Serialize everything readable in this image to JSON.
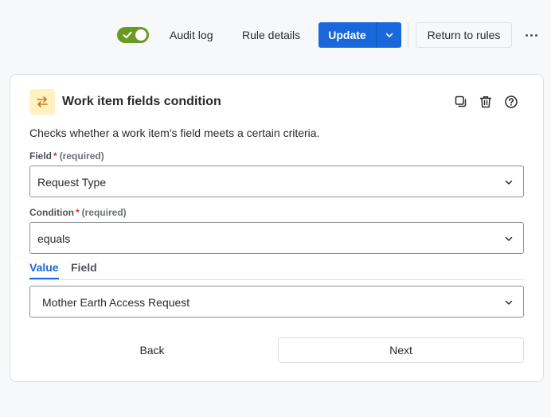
{
  "toolbar": {
    "rule_enabled": true,
    "audit_log_label": "Audit log",
    "rule_details_label": "Rule details",
    "update_label": "Update",
    "return_label": "Return to rules",
    "accent_color": "#1868db",
    "toggle_color": "#6a9a23"
  },
  "card": {
    "icon": "swap-arrows-icon",
    "title": "Work item fields condition",
    "actions": [
      "copy-icon",
      "trash-icon",
      "help-icon"
    ],
    "description": "Checks whether a work item's field meets a certain criteria.",
    "field": {
      "label": "Field",
      "required_mark": "*",
      "required_text": "(required)",
      "value": "Request Type"
    },
    "condition": {
      "label": "Condition",
      "required_mark": "*",
      "required_text": "(required)",
      "value": "equals"
    },
    "tabs": [
      {
        "label": "Value",
        "active": true
      },
      {
        "label": "Field",
        "active": false
      }
    ],
    "value_select": "Mother Earth Access Request",
    "back_label": "Back",
    "next_label": "Next"
  }
}
